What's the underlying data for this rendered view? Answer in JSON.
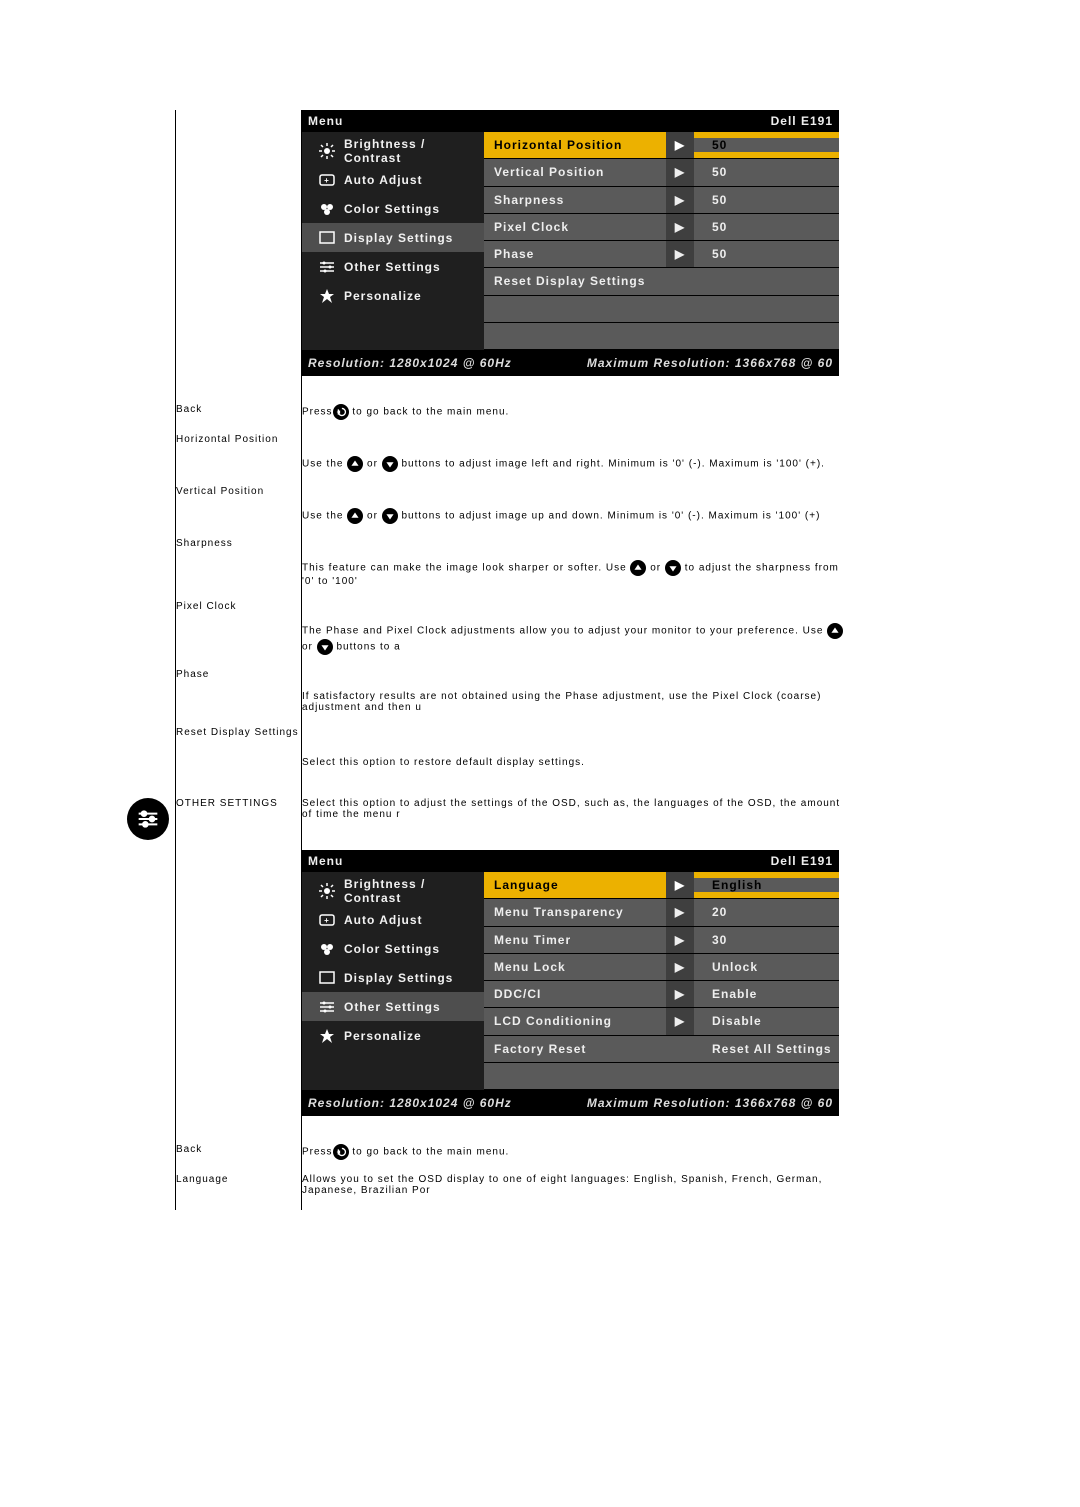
{
  "osd_display": {
    "title_left": "Menu",
    "title_right": "Dell E191",
    "foot_left": "Resolution: 1280x1024 @ 60Hz",
    "foot_right": "Maximum Resolution: 1366x768 @ 60",
    "left_items": [
      {
        "icon": "brightness",
        "label": "Brightness / Contrast"
      },
      {
        "icon": "auto",
        "label": "Auto Adjust"
      },
      {
        "icon": "color",
        "label": "Color Settings"
      },
      {
        "icon": "display",
        "label": "Display Settings",
        "selected": true
      },
      {
        "icon": "other",
        "label": "Other Settings"
      },
      {
        "icon": "star",
        "label": "Personalize"
      }
    ],
    "right_items": [
      {
        "label": "Horizontal Position",
        "value": "50",
        "selected": true
      },
      {
        "label": "Vertical Position",
        "value": "50"
      },
      {
        "label": "Sharpness",
        "value": "50"
      },
      {
        "label": "Pixel Clock",
        "value": "50"
      },
      {
        "label": "Phase",
        "value": "50"
      },
      {
        "label": "Reset Display Settings",
        "value": "",
        "noarrow": true
      }
    ]
  },
  "osd_other": {
    "title_left": "Menu",
    "title_right": "Dell E191",
    "foot_left": "Resolution: 1280x1024 @ 60Hz",
    "foot_right": "Maximum Resolution: 1366x768 @ 60",
    "left_items": [
      {
        "icon": "brightness",
        "label": "Brightness / Contrast"
      },
      {
        "icon": "auto",
        "label": "Auto Adjust"
      },
      {
        "icon": "color",
        "label": "Color Settings"
      },
      {
        "icon": "display",
        "label": "Display Settings"
      },
      {
        "icon": "other",
        "label": "Other Settings",
        "selected": true
      },
      {
        "icon": "star",
        "label": "Personalize"
      }
    ],
    "right_items": [
      {
        "label": "Language",
        "value": "English",
        "selected": true
      },
      {
        "label": "Menu Transparency",
        "value": "20"
      },
      {
        "label": "Menu Timer",
        "value": "30"
      },
      {
        "label": "Menu Lock",
        "value": "Unlock"
      },
      {
        "label": "DDC/CI",
        "value": "Enable"
      },
      {
        "label": "LCD Conditioning",
        "value": "Disable"
      },
      {
        "label": "Factory Reset",
        "value": "Reset All Settings",
        "noarrow": true
      }
    ]
  },
  "rows": {
    "back1_label": "Back",
    "back1_desc_pre": "Press",
    "back1_desc_post": " to go back to the main menu.",
    "hpos_label": "Horizontal Position",
    "hpos_pre": "Use the ",
    "hpos_mid": " or ",
    "hpos_post": " buttons to adjust image left and right. Minimum is '0' (-). Maximum is '100' (+).",
    "vpos_label": "Vertical Position",
    "vpos_pre": "Use the ",
    "vpos_mid": " or ",
    "vpos_post": " buttons to adjust image up and down. Minimum is '0' (-). Maximum is '100' (+)",
    "sharp_label": "Sharpness",
    "sharp_pre": "This feature can make the image look sharper or softer. Use ",
    "sharp_mid": " or ",
    "sharp_post": " to adjust the sharpness from '0' to '100'",
    "pclock_label": "Pixel Clock",
    "pclock_pre": "The Phase and Pixel Clock adjustments allow you to adjust your monitor to your preference. Use ",
    "pclock_mid": " or ",
    "pclock_post": " buttons to a",
    "phase_label": "Phase",
    "phase_desc": "If satisfactory results are not obtained using the Phase adjustment, use the Pixel Clock (coarse) adjustment and then u",
    "reset_label": "Reset Display Settings",
    "reset_desc": "Select this option to restore default display settings.",
    "other_label": "OTHER SETTINGS",
    "other_desc": "Select this option to adjust the settings of the OSD, such as, the languages of the OSD, the amount of time the menu r",
    "back2_label": "Back",
    "back2_desc_pre": "Press",
    "back2_desc_post": " to go back to the main menu.",
    "lang_label": "Language",
    "lang_desc": "Allows you to set the OSD display to one of eight languages: English, Spanish, French, German, Japanese, Brazilian Por"
  }
}
